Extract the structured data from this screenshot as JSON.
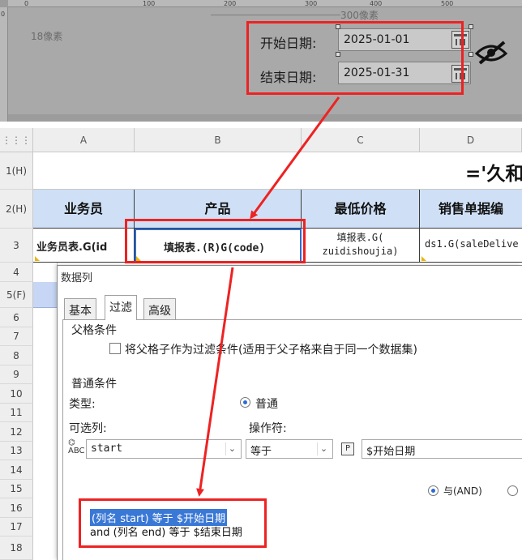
{
  "designer": {
    "ruler_ticks": [
      "0",
      "100",
      "200",
      "300",
      "400",
      "500"
    ],
    "ruler_v_tick": "0",
    "width_hint": "300像素",
    "left_hint": "18像素",
    "start_label": "开始日期:",
    "start_value": "2025-01-01",
    "end_label": "结束日期:",
    "end_value": "2025-01-31"
  },
  "sheet": {
    "corner_icon": "grid-icon",
    "columns": [
      "A",
      "B",
      "C",
      "D"
    ],
    "rows": [
      "1(H)",
      "2(H)",
      "3",
      "4",
      "5(F)",
      "6",
      "7",
      "8",
      "9",
      "10",
      "11",
      "12",
      "13",
      "14",
      "15",
      "16",
      "17",
      "18"
    ],
    "title": "='久和",
    "headers": [
      "业务员",
      "产品",
      "最低价格",
      "销售单据编"
    ],
    "cells": {
      "a3": "业务员表.G(id",
      "b3": "填报表.(R)G(code)",
      "c3_line1": "填报表.G(",
      "c3_line2": "zuidishoujia)",
      "d3": "ds1.G(saleDelive"
    }
  },
  "dialog": {
    "title": "数据列",
    "tabs": [
      "基本",
      "过滤",
      "高级"
    ],
    "active_tab": "过滤",
    "parent_condition_title": "父格条件",
    "parent_checkbox_label": "将父格子作为过滤条件(适用于父子格来自于同一个数据集)",
    "normal_condition_title": "普通条件",
    "type_label": "类型:",
    "type_option": "普通",
    "column_label": "可选列:",
    "operator_label": "操作符:",
    "column_value": "start",
    "operator_value": "等于",
    "param_icon": "P",
    "param_value": "$开始日期",
    "and_label": "与(AND)",
    "conditions": [
      "(列名 start) 等于 $开始日期",
      "and (列名 end) 等于 $结束日期"
    ]
  },
  "colors": {
    "annotation_red": "#ee2222",
    "header_blue": "#cfe0f6",
    "selection_blue": "#3a78d6"
  }
}
